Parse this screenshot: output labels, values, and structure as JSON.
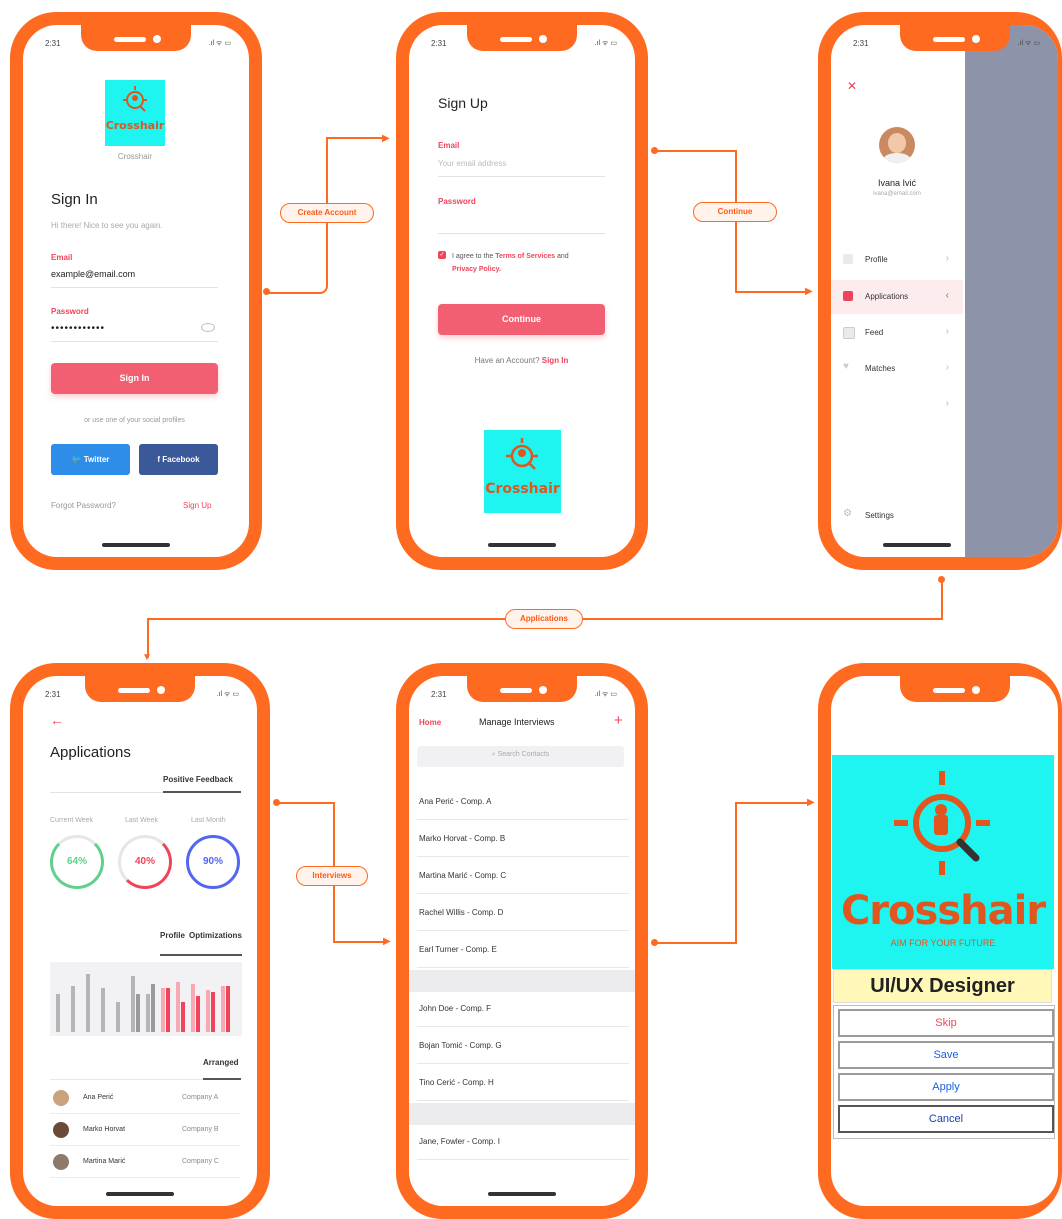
{
  "status": {
    "time": "2:31",
    "signal": ".ıl ᯤ ▭"
  },
  "connectors": {
    "create_account": "Create Account",
    "continue": "Continue",
    "applications": "Applications",
    "interviews": "Interviews"
  },
  "brand": {
    "name": "Crosshair",
    "tagline": "AIM FOR YOUR FUTURE"
  },
  "signin": {
    "logo_caption": "Crosshair",
    "title": "Sign In",
    "subtitle": "Hi there! Nice to see you again.",
    "email_label": "Email",
    "email_value": "example@email.com",
    "password_label": "Password",
    "password_value": "••••••••••••",
    "submit": "Sign In",
    "social_hint": "or use one of your social profiles",
    "twitter": "Twitter",
    "facebook": "Facebook",
    "forgot": "Forgot Password?",
    "signup": "Sign Up"
  },
  "signup": {
    "title": "Sign Up",
    "email_label": "Email",
    "email_placeholder": "Your email address",
    "password_label": "Password",
    "agree_prefix": "I agree to the ",
    "terms": "Terms of Services",
    "agree_and": " and",
    "privacy": "Privacy Policy.",
    "submit": "Continue",
    "have_account": "Have an Account?",
    "signin_link": "Sign In"
  },
  "menu": {
    "close": "✕",
    "user_name": "Ivana Ivić",
    "user_email": "ivana@email.com",
    "items": [
      {
        "label": "Profile",
        "icon": "home-icon"
      },
      {
        "label": "Applications",
        "icon": "applications-icon"
      },
      {
        "label": "Feed",
        "icon": "feed-icon"
      },
      {
        "label": "Matches",
        "icon": "heart-icon"
      },
      {
        "label": "",
        "icon": ""
      }
    ],
    "settings": "Settings"
  },
  "applications": {
    "back": "←",
    "title": "Applications",
    "tab_feedback": "Positive Feedback",
    "periods": [
      "Current Week",
      "Last Week",
      "Last Month"
    ],
    "percents": [
      "64%",
      "40%",
      "90%"
    ],
    "ring_values": [
      64,
      40,
      90
    ],
    "ring_colors": [
      "#5fd18c",
      "#f0445a",
      "#5266f0"
    ],
    "tab_profile": "Profile",
    "tab_optim": "Optimizations",
    "tab_arranged": "Arranged",
    "people": [
      {
        "name": "Ana Perić",
        "company": "Company A"
      },
      {
        "name": "Marko Horvat",
        "company": "Company B"
      },
      {
        "name": "Martina Marić",
        "company": "Company C"
      }
    ]
  },
  "interviews": {
    "home": "Home",
    "title": "Manage Interviews",
    "add": "+",
    "search_placeholder": "Search Contacts",
    "group1": [
      "Ana Perić - Comp. A",
      "Marko Horvat - Comp. B",
      "Martina Marić - Comp. C",
      "Rachel Willis - Comp. D",
      "Earl Turner - Comp. E"
    ],
    "group2": [
      "John Doe - Comp. F",
      "Bojan Tomić - Comp. G",
      "Tino Cerić - Comp. H"
    ],
    "group3": [
      "Jane, Fowler - Comp. I"
    ]
  },
  "job": {
    "role": "UI/UX Designer",
    "actions": [
      "Skip",
      "Save",
      "Apply",
      "Cancel"
    ],
    "action_colors": [
      "#f0445a",
      "#1a5fe0",
      "#1a5fe0",
      "#1a3fb0"
    ]
  }
}
